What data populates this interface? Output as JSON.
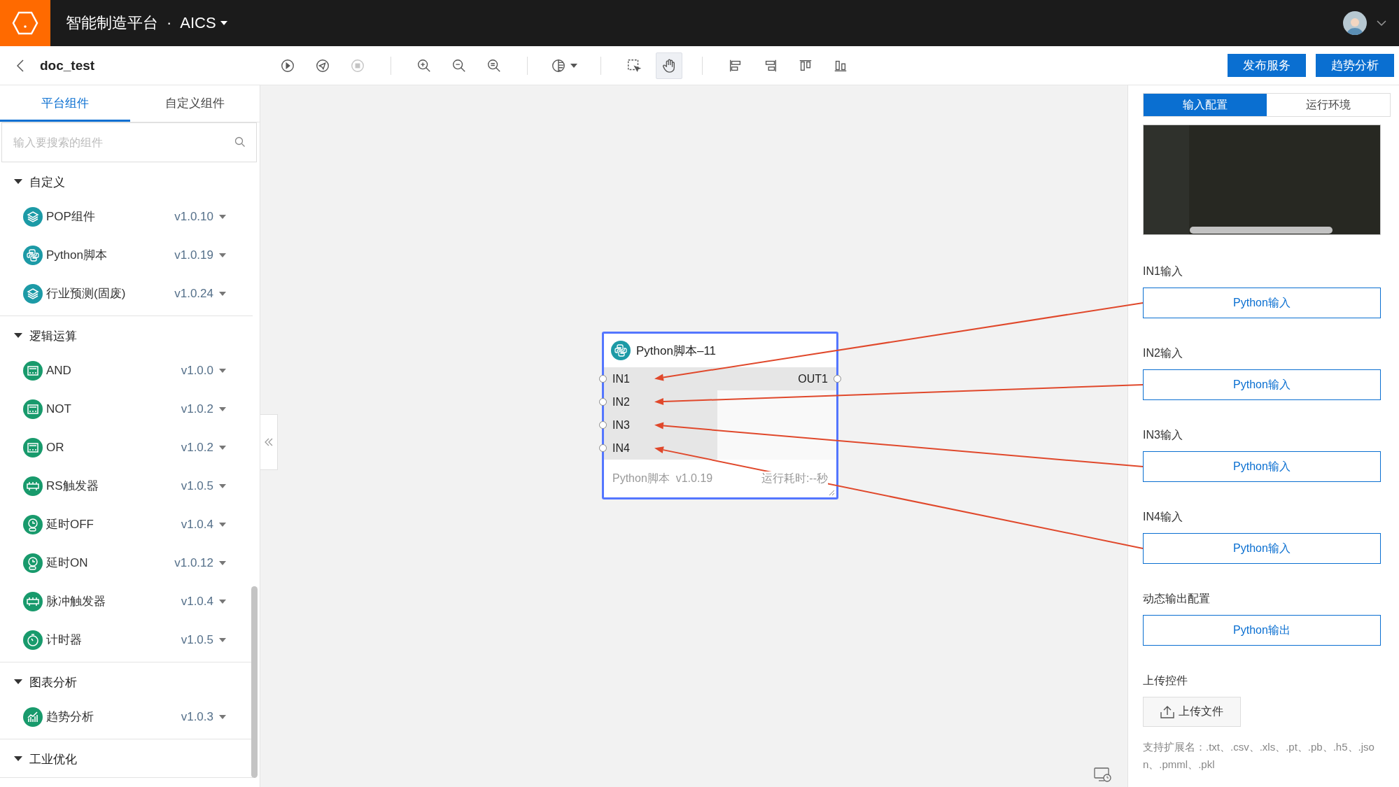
{
  "header": {
    "title": "智能制造平台",
    "separator": "·",
    "product": "AICS"
  },
  "toolbar": {
    "document": "doc_test",
    "tools": [
      {
        "kind": "run",
        "selected": false,
        "disabled": false
      },
      {
        "kind": "send",
        "selected": false,
        "disabled": false
      },
      {
        "kind": "stop",
        "selected": false,
        "disabled": true
      },
      {
        "kind": "zoom-in",
        "selected": false,
        "disabled": false
      },
      {
        "kind": "zoom-out",
        "selected": false,
        "disabled": false
      },
      {
        "kind": "zoom-reset",
        "selected": false,
        "disabled": false
      },
      {
        "kind": "theme",
        "selected": false,
        "disabled": false
      },
      {
        "kind": "box-select",
        "selected": false,
        "disabled": false
      },
      {
        "kind": "hand",
        "selected": true,
        "disabled": false
      },
      {
        "kind": "align-left",
        "selected": false,
        "disabled": false
      },
      {
        "kind": "align-right",
        "selected": false,
        "disabled": false
      },
      {
        "kind": "align-top",
        "selected": false,
        "disabled": false
      },
      {
        "kind": "align-bottom",
        "selected": false,
        "disabled": false
      }
    ],
    "actions": [
      "发布服务",
      "趋势分析"
    ]
  },
  "sidebar": {
    "tabs": [
      {
        "label": "平台组件",
        "selected": true
      },
      {
        "label": "自定义组件",
        "selected": false
      }
    ],
    "search": {
      "placeholder": "输入要搜索的组件"
    },
    "groups": [
      {
        "name": "自定义",
        "expanded": true,
        "items": [
          {
            "name": "POP组件",
            "version": "v1.0.10",
            "kind": "layers",
            "color": "#1c9aa6"
          },
          {
            "name": "Python脚本",
            "version": "v1.0.19",
            "kind": "python",
            "color": "#1c9aa6"
          },
          {
            "name": "行业预测(固废)",
            "version": "v1.0.24",
            "kind": "layers",
            "color": "#1c9aa6"
          }
        ]
      },
      {
        "name": "逻辑运算",
        "expanded": true,
        "items": [
          {
            "name": "AND",
            "version": "v1.0.0",
            "kind": "gate",
            "color": "#189a6c"
          },
          {
            "name": "NOT",
            "version": "v1.0.2",
            "kind": "gate",
            "color": "#189a6c"
          },
          {
            "name": "OR",
            "version": "v1.0.2",
            "kind": "gate",
            "color": "#189a6c"
          },
          {
            "name": "RS触发器",
            "version": "v1.0.5",
            "kind": "trigger",
            "color": "#189a6c"
          },
          {
            "name": "延时OFF",
            "version": "v1.0.4",
            "kind": "delay",
            "color": "#189a6c"
          },
          {
            "name": "延时ON",
            "version": "v1.0.12",
            "kind": "delay",
            "color": "#189a6c"
          },
          {
            "name": "脉冲触发器",
            "version": "v1.0.4",
            "kind": "trigger",
            "color": "#189a6c"
          },
          {
            "name": "计时器",
            "version": "v1.0.5",
            "kind": "timer",
            "color": "#189a6c"
          }
        ]
      },
      {
        "name": "图表分析",
        "expanded": true,
        "items": [
          {
            "name": "趋势分析",
            "version": "v1.0.3",
            "kind": "chart",
            "color": "#189a6c"
          }
        ]
      },
      {
        "name": "工业优化",
        "expanded": true
      }
    ]
  },
  "canvas": {
    "node": {
      "title": "Python脚本–11",
      "selected": true,
      "inputs": [
        "IN1",
        "IN2",
        "IN3",
        "IN4"
      ],
      "outputs": [
        "OUT1"
      ],
      "component": "Python脚本",
      "version": "v1.0.19",
      "runtime": "运行耗时:--秒"
    }
  },
  "panel": {
    "tabs": [
      {
        "label": "输入配置",
        "selected": true
      },
      {
        "label": "运行环境",
        "selected": false
      }
    ],
    "inputs": [
      {
        "label": "IN1输入",
        "button": "Python输入"
      },
      {
        "label": "IN2输入",
        "button": "Python输入"
      },
      {
        "label": "IN3输入",
        "button": "Python输入"
      },
      {
        "label": "IN4输入",
        "button": "Python输入"
      }
    ],
    "output": {
      "label": "动态输出配置",
      "button": "Python输出"
    },
    "upload": {
      "label": "上传控件",
      "button": "上传文件",
      "hint": "支持扩展名：.txt、.csv、.xls、.pt、.pb、.h5、.json、.pmml、.pkl"
    }
  }
}
